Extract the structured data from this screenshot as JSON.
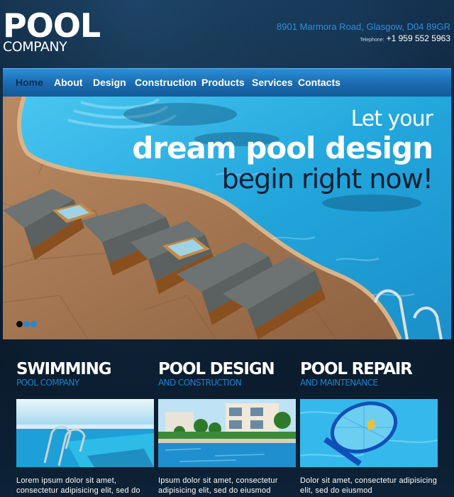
{
  "header": {
    "logo_main": "POOL",
    "logo_sub": "COMPANY",
    "address": "8901 Marmora Road, Glasgow, D04 89GR",
    "phone_label": "Telephone:",
    "phone": "+1 959 552 5963"
  },
  "nav": {
    "items": [
      {
        "label": "Home",
        "active": true
      },
      {
        "label": "About",
        "active": false
      },
      {
        "label": "Design",
        "active": false
      },
      {
        "label": "Construction",
        "active": false
      },
      {
        "label": "Products",
        "active": false
      },
      {
        "label": "Services",
        "active": false
      },
      {
        "label": "Contacts",
        "active": false
      }
    ]
  },
  "hero": {
    "line1": "Let your",
    "line2": "dream pool design",
    "line3": "begin right now!",
    "slides": 3,
    "active_slide": 1
  },
  "sections": [
    {
      "title": "SWIMMING",
      "subtitle": "POOL COMPANY",
      "text": "Lorem ipsum dolor sit amet, consectetur adipisicing elit, sed do eiusmod"
    },
    {
      "title": "POOL DESIGN",
      "subtitle": "AND CONSTRUCTION",
      "text": "Ipsum dolor sit amet, consectetur adipisicing elit, sed do eiusmod tempor"
    },
    {
      "title": "POOL REPAIR",
      "subtitle": "AND MAINTENANCE",
      "text": "Dolor sit amet, consectetur adipisicing elit, sed do eiusmod"
    }
  ],
  "colors": {
    "accent": "#1f80cc",
    "nav_top": "#2b8fd6",
    "nav_active": "#0b2f55",
    "background": "#0b1c2c",
    "pool_water": "#2fb0e0"
  }
}
